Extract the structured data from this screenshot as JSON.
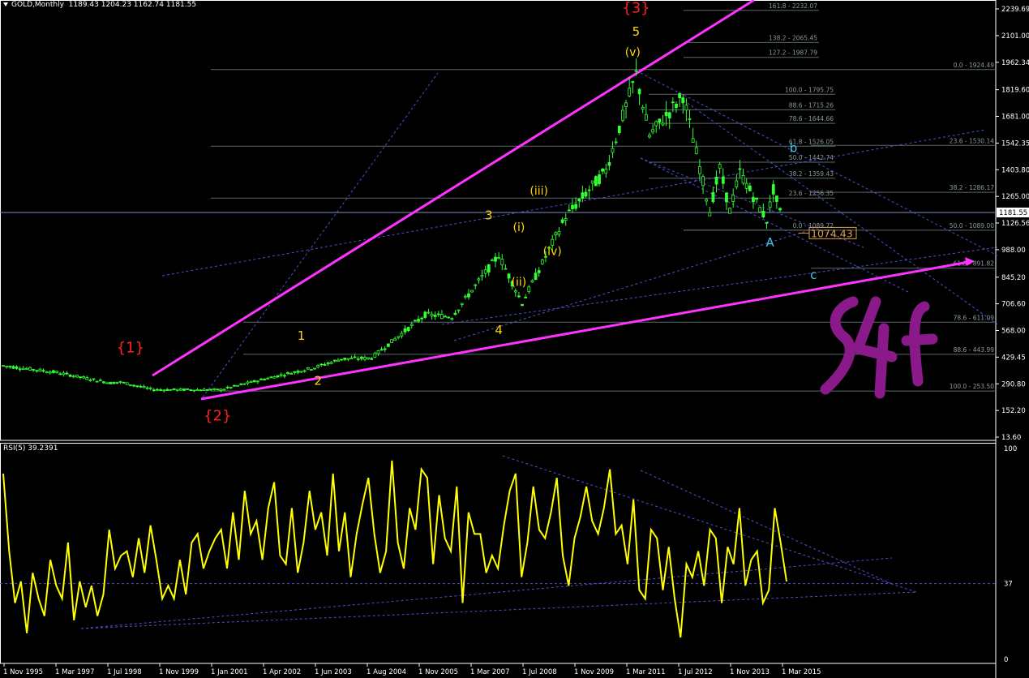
{
  "header": {
    "symbol": "GOLD,Monthly",
    "ohlc": "1189.43 1204.23 1162.74 1181.55"
  },
  "rsi_header": {
    "label": "RSI(5) 39.2391"
  },
  "colors": {
    "background": "#000000",
    "grid": "#ffffff",
    "candle": "#33ff33",
    "channel": "#ff33ff",
    "trend_dashed": "#4f4fd0",
    "fib": "#5a6a6a",
    "rsi_line": "#ffff00",
    "wave_red": "#ff2020",
    "wave_yellow": "#ffd700",
    "wave_cyan": "#40c8e8"
  },
  "chart_data": [
    {
      "type": "candlestick",
      "title": "GOLD,Monthly",
      "current_price": 1181.55,
      "ylim": [
        13.6,
        2239.69
      ],
      "price_axis_ticks": [
        "2239.69",
        "2101.00",
        "1962.34",
        "1819.60",
        "1681.00",
        "1542.35",
        "1403.80",
        "1265.00",
        "1126.56",
        "988.00",
        "845.20",
        "706.60",
        "568.00",
        "429.45",
        "290.80",
        "152.20",
        "13.60"
      ],
      "current_price_label": "1181.55",
      "time_axis_labels": [
        "1 Nov 1995",
        "1 Mar 1997",
        "1 Jul 1998",
        "1 Nov 1999",
        "1 Jan 2001",
        "1 Apr 2002",
        "1 Jun 2003",
        "1 Aug 2004",
        "1 Nov 2005",
        "1 Mar 2007",
        "1 Jul 2008",
        "1 Nov 2009",
        "1 Mar 2011",
        "1 Jul 2012",
        "1 Nov 2013",
        "1 Mar 2015"
      ],
      "price_path": [
        {
          "date": "1995-11",
          "price": 385
        },
        {
          "date": "1997-03",
          "price": 350
        },
        {
          "date": "1998-07",
          "price": 295
        },
        {
          "date": "1998-10",
          "price": 300
        },
        {
          "date": "1999-08",
          "price": 260
        },
        {
          "date": "2001-04",
          "price": 260
        },
        {
          "date": "2002-06",
          "price": 320
        },
        {
          "date": "2003-08",
          "price": 375
        },
        {
          "date": "2004-04",
          "price": 420
        },
        {
          "date": "2005-01",
          "price": 425
        },
        {
          "date": "2006-05",
          "price": 650
        },
        {
          "date": "2007-01",
          "price": 640
        },
        {
          "date": "2008-03",
          "price": 960
        },
        {
          "date": "2008-10",
          "price": 710
        },
        {
          "date": "2009-11",
          "price": 1160
        },
        {
          "date": "2010-11",
          "price": 1400
        },
        {
          "date": "2011-08",
          "price": 1900
        },
        {
          "date": "2011-12",
          "price": 1580
        },
        {
          "date": "2012-10",
          "price": 1790
        },
        {
          "date": "2013-06",
          "price": 1190
        },
        {
          "date": "2013-09",
          "price": 1410
        },
        {
          "date": "2013-12",
          "price": 1190
        },
        {
          "date": "2014-03",
          "price": 1390
        },
        {
          "date": "2014-11",
          "price": 1140
        },
        {
          "date": "2015-01",
          "price": 1300
        },
        {
          "date": "2015-03",
          "price": 1181
        }
      ],
      "fibonacci_levels": [
        {
          "label": "161.8 - 2232.07",
          "price": 2232.07
        },
        {
          "label": "138.2 - 2065.45",
          "price": 2065.45
        },
        {
          "label": "127.2 - 1987.79",
          "price": 1987.79
        },
        {
          "label": "0.0 - 1924.49",
          "price": 1924.49
        },
        {
          "label": "100.0 - 1795.75",
          "price": 1795.75
        },
        {
          "label": "88.6 - 1715.26",
          "price": 1715.26
        },
        {
          "label": "78.6 - 1644.66",
          "price": 1644.66
        },
        {
          "label": "61.8 - 1526.05",
          "price": 1526.05
        },
        {
          "label": "23.6 - 1530.14",
          "price": 1530.14
        },
        {
          "label": "50.0 - 1442.74",
          "price": 1442.74
        },
        {
          "label": "38.2 - 1359.43",
          "price": 1359.43
        },
        {
          "label": "38.2 - 1286.17",
          "price": 1286.17
        },
        {
          "label": "23.6 - 1256.35",
          "price": 1256.35
        },
        {
          "label": "0.0 - 1089.72",
          "price": 1089.72
        },
        {
          "label": "50.0 - 1089.00",
          "price": 1089.0
        },
        {
          "label": "61.8 - 891.82",
          "price": 891.82
        },
        {
          "label": "78.6 - 611.09",
          "price": 611.09
        },
        {
          "label": "88.6 - 443.99",
          "price": 443.99
        },
        {
          "label": "100.0 - 253.50",
          "price": 253.5
        }
      ],
      "price_tag": "1074.43",
      "wave_labels": [
        {
          "text": "{1}",
          "color": "red",
          "date": "1999-01",
          "price": 455
        },
        {
          "text": "{2}",
          "color": "red",
          "date": "2001-03",
          "price": 100
        },
        {
          "text": "{3}",
          "color": "red",
          "date": "2011-08",
          "price": 2220
        },
        {
          "text": "1",
          "color": "yellow",
          "date": "2003-04",
          "price": 520
        },
        {
          "text": "2",
          "color": "yellow",
          "date": "2003-09",
          "price": 285
        },
        {
          "text": "3",
          "color": "yellow",
          "date": "2007-12",
          "price": 1145
        },
        {
          "text": "4",
          "color": "yellow",
          "date": "2008-03",
          "price": 548
        },
        {
          "text": "5",
          "color": "yellow",
          "date": "2011-08",
          "price": 2100
        },
        {
          "text": "(i)",
          "color": "yellow",
          "date": "2008-09",
          "price": 1085
        },
        {
          "text": "(ii)",
          "color": "yellow",
          "date": "2008-09",
          "price": 800
        },
        {
          "text": "(iii)",
          "color": "yellow",
          "date": "2009-03",
          "price": 1275
        },
        {
          "text": "(iv)",
          "color": "yellow",
          "date": "2009-07",
          "price": 960
        },
        {
          "text": "(v)",
          "color": "yellow",
          "date": "2011-07",
          "price": 1995
        },
        {
          "text": "A",
          "color": "cyan",
          "date": "2014-12",
          "price": 1005
        },
        {
          "text": "b",
          "color": "cyan",
          "date": "2015-07",
          "price": 1495
        },
        {
          "text": "c",
          "color": "cyan",
          "date": "2016-01",
          "price": 835
        }
      ],
      "handwritten_mark": "S4F"
    },
    {
      "type": "line",
      "name": "RSI(5)",
      "current_value": 39.2391,
      "ylim": [
        0,
        100
      ],
      "axis_ticks": [
        "100",
        "37",
        "0"
      ],
      "reference_level": 37,
      "series": [
        {
          "name": "RSI(5)",
          "values": [
            88,
            52,
            28,
            38,
            14,
            42,
            30,
            22,
            48,
            36,
            30,
            56,
            20,
            38,
            26,
            36,
            22,
            32,
            62,
            44,
            50,
            52,
            40,
            58,
            42,
            64,
            48,
            30,
            36,
            30,
            48,
            32,
            56,
            60,
            44,
            52,
            58,
            62,
            44,
            70,
            48,
            80,
            60,
            66,
            48,
            72,
            84,
            50,
            46,
            72,
            42,
            56,
            80,
            62,
            70,
            50,
            88,
            52,
            70,
            40,
            60,
            74,
            86,
            60,
            42,
            52,
            94,
            56,
            44,
            72,
            62,
            90,
            86,
            46,
            78,
            58,
            52,
            82,
            28,
            70,
            60,
            60,
            42,
            50,
            44,
            64,
            80,
            88,
            40,
            56,
            82,
            62,
            58,
            70,
            86,
            50,
            36,
            58,
            68,
            82,
            66,
            60,
            72,
            90,
            60,
            64,
            46,
            76,
            34,
            30,
            62,
            58,
            34,
            54,
            30,
            12,
            46,
            40,
            52,
            36,
            62,
            58,
            28,
            54,
            46,
            72,
            36,
            48,
            52,
            28,
            34,
            72,
            56,
            38
          ]
        }
      ]
    }
  ]
}
